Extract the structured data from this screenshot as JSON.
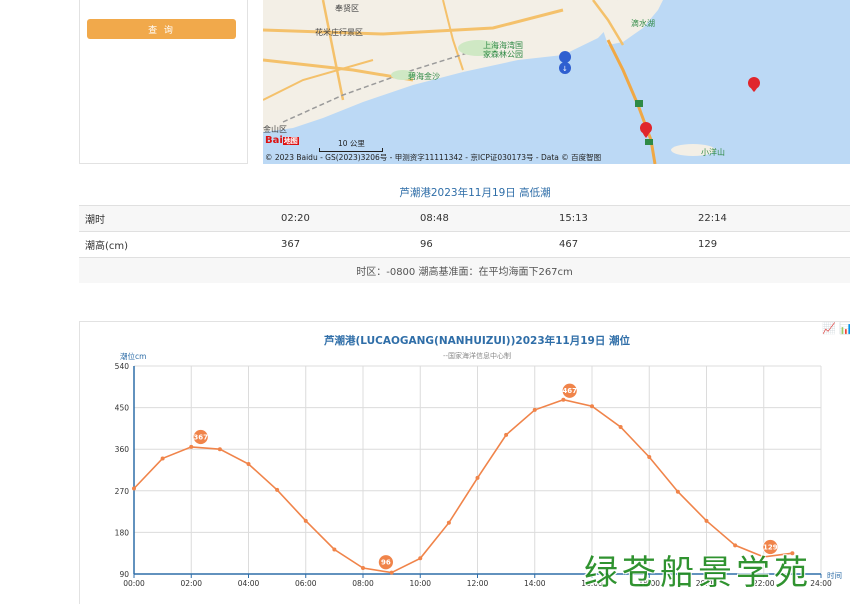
{
  "search": {
    "query_label": "查 询"
  },
  "map": {
    "labels": {
      "fengxian": "奉贤区",
      "huamizhuang": "花米庄行景区",
      "haiwanguo": "上海海湾国",
      "senlingongyuan": "家森林公园",
      "bihaijinsha": "碧海金沙",
      "dishuihu": "滴水湖",
      "jinshan": "金山区",
      "xiaoyangshan": "小洋山"
    },
    "scale": "10 公里",
    "copyright": "© 2023 Baidu - GS(2023)3206号 - 甲测资字11111342 - 京ICP证030173号 - Data © 百度智图",
    "logo": "Bai",
    "logo_badge": "地图"
  },
  "tide_table": {
    "title": "芦潮港2023年11月19日 高低潮",
    "time_label": "潮时",
    "height_label": "潮高(cm)",
    "times": [
      "02:20",
      "08:48",
      "15:13",
      "22:14"
    ],
    "heights": [
      "367",
      "96",
      "467",
      "129"
    ],
    "note": "时区：-0800 潮高基准面：在平均海面下267cm"
  },
  "chart_data": {
    "type": "line",
    "title": "芦潮港(LUCAOGANG(NANHUIZUI))2023年11月19日 潮位",
    "subtitle": "--国家海洋信息中心制",
    "ylabel": "潮位cm",
    "xlabel": "时间",
    "ylim": [
      90,
      540
    ],
    "yticks": [
      90,
      180,
      270,
      360,
      450,
      540
    ],
    "xticks": [
      "00:00",
      "02:00",
      "04:00",
      "06:00",
      "08:00",
      "10:00",
      "12:00",
      "14:00",
      "16:00",
      "18:00",
      "20:00",
      "22:00",
      "24:00"
    ],
    "x_hours": [
      0,
      1,
      2,
      3,
      4,
      5,
      6,
      7,
      8,
      9,
      10,
      11,
      12,
      13,
      14,
      15,
      16,
      17,
      18,
      19,
      20,
      21,
      22,
      23
    ],
    "values": [
      275,
      340,
      365,
      360,
      328,
      272,
      205,
      143,
      103,
      93,
      124,
      201,
      298,
      391,
      445,
      467,
      453,
      408,
      343,
      268,
      205,
      152,
      127,
      135
    ],
    "extremes": [
      {
        "hour": 2.33,
        "value": 367,
        "label": "367"
      },
      {
        "hour": 8.8,
        "value": 96,
        "label": "96"
      },
      {
        "hour": 15.22,
        "value": 467,
        "label": "467"
      },
      {
        "hour": 22.23,
        "value": 129,
        "label": "129"
      }
    ],
    "line_color": "#f0844a",
    "axis_color": "#2f6ea8",
    "grid": true
  },
  "watermark": "绿苍船景学苑",
  "colors": {
    "accent": "#f1a94b",
    "title_blue": "#2f6ea8"
  }
}
